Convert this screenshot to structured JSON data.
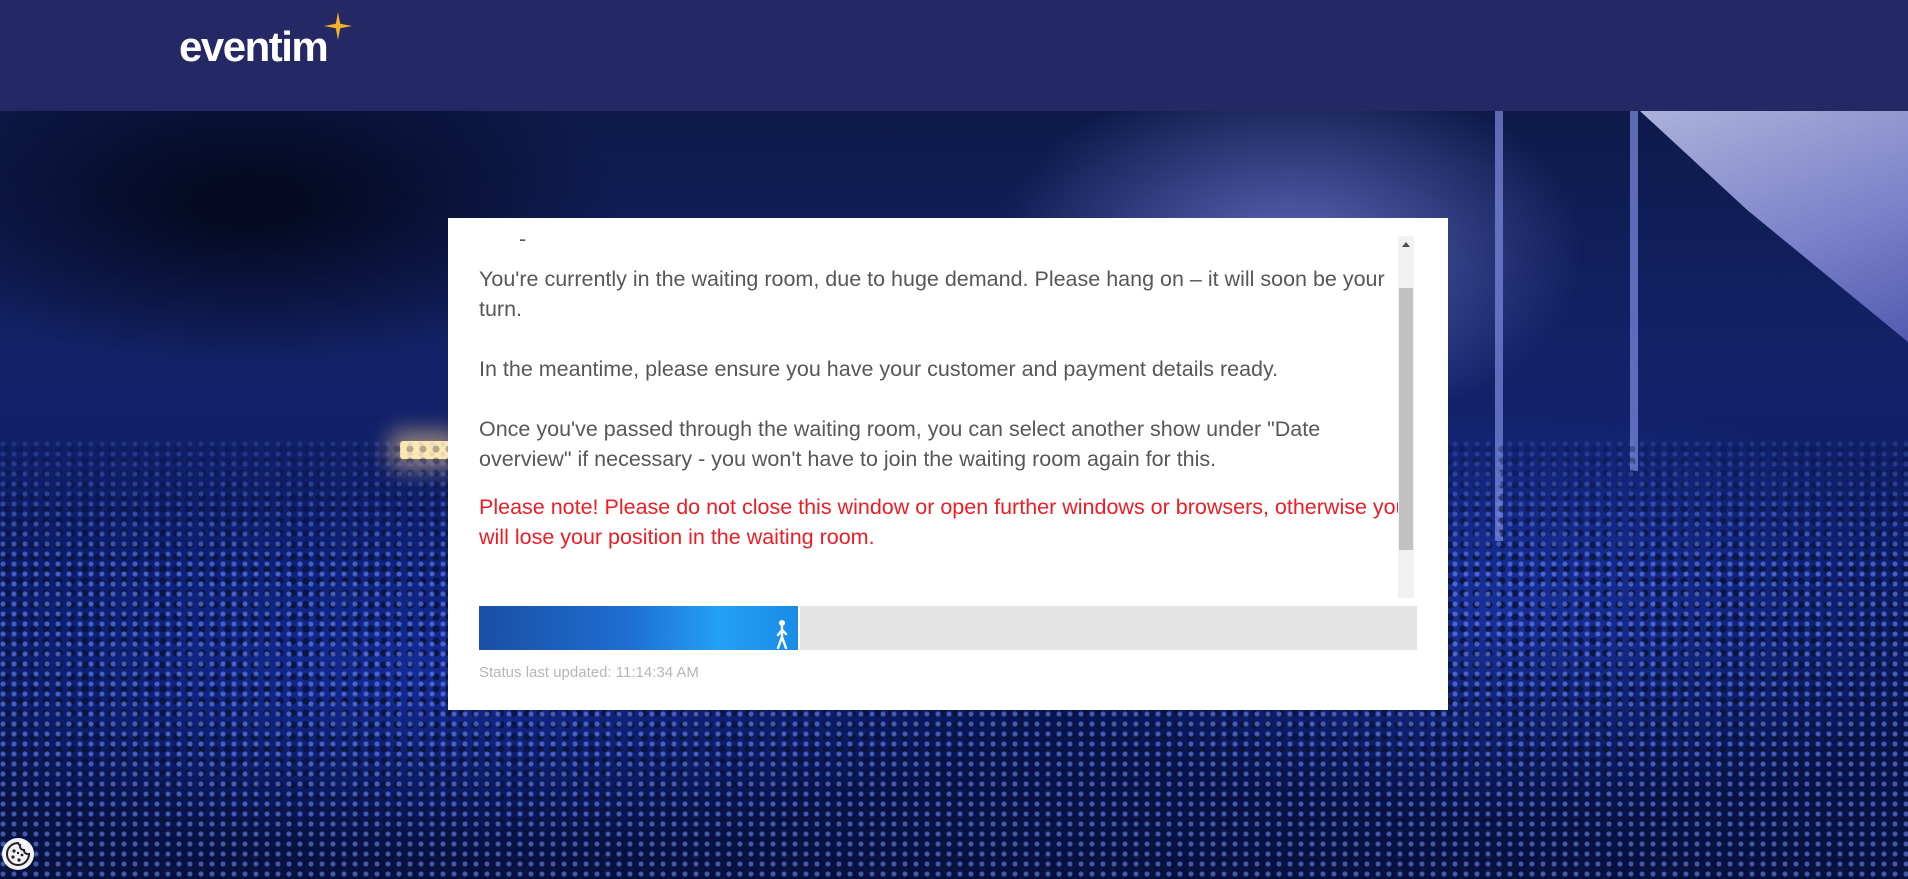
{
  "header": {
    "logo_text": "eventim",
    "logo_icon": "sparkle-star-icon",
    "background_color": "#242864",
    "accent_color": "#f5b324"
  },
  "waiting_room": {
    "dash": "-",
    "paragraphs": [
      "You're currently in the waiting room, due to huge demand. Please hang on – it will soon be your turn.",
      "In the meantime, please ensure you have your customer and payment details ready.",
      "Once you've passed through the waiting room, you can select another show under \"Date overview\" if necessary - you won't have to join the waiting room again for this."
    ],
    "warning": "Please note! Please do not close this window or open further windows or browsers, otherwise you will lose your position in the waiting room.",
    "warning_color": "#ee1c25",
    "progress_fraction": 0.34,
    "progress_icon": "walking-person-icon",
    "status_text": "Status last updated: 11:14:34 AM"
  },
  "cookie_button": {
    "icon": "cookie-icon"
  }
}
